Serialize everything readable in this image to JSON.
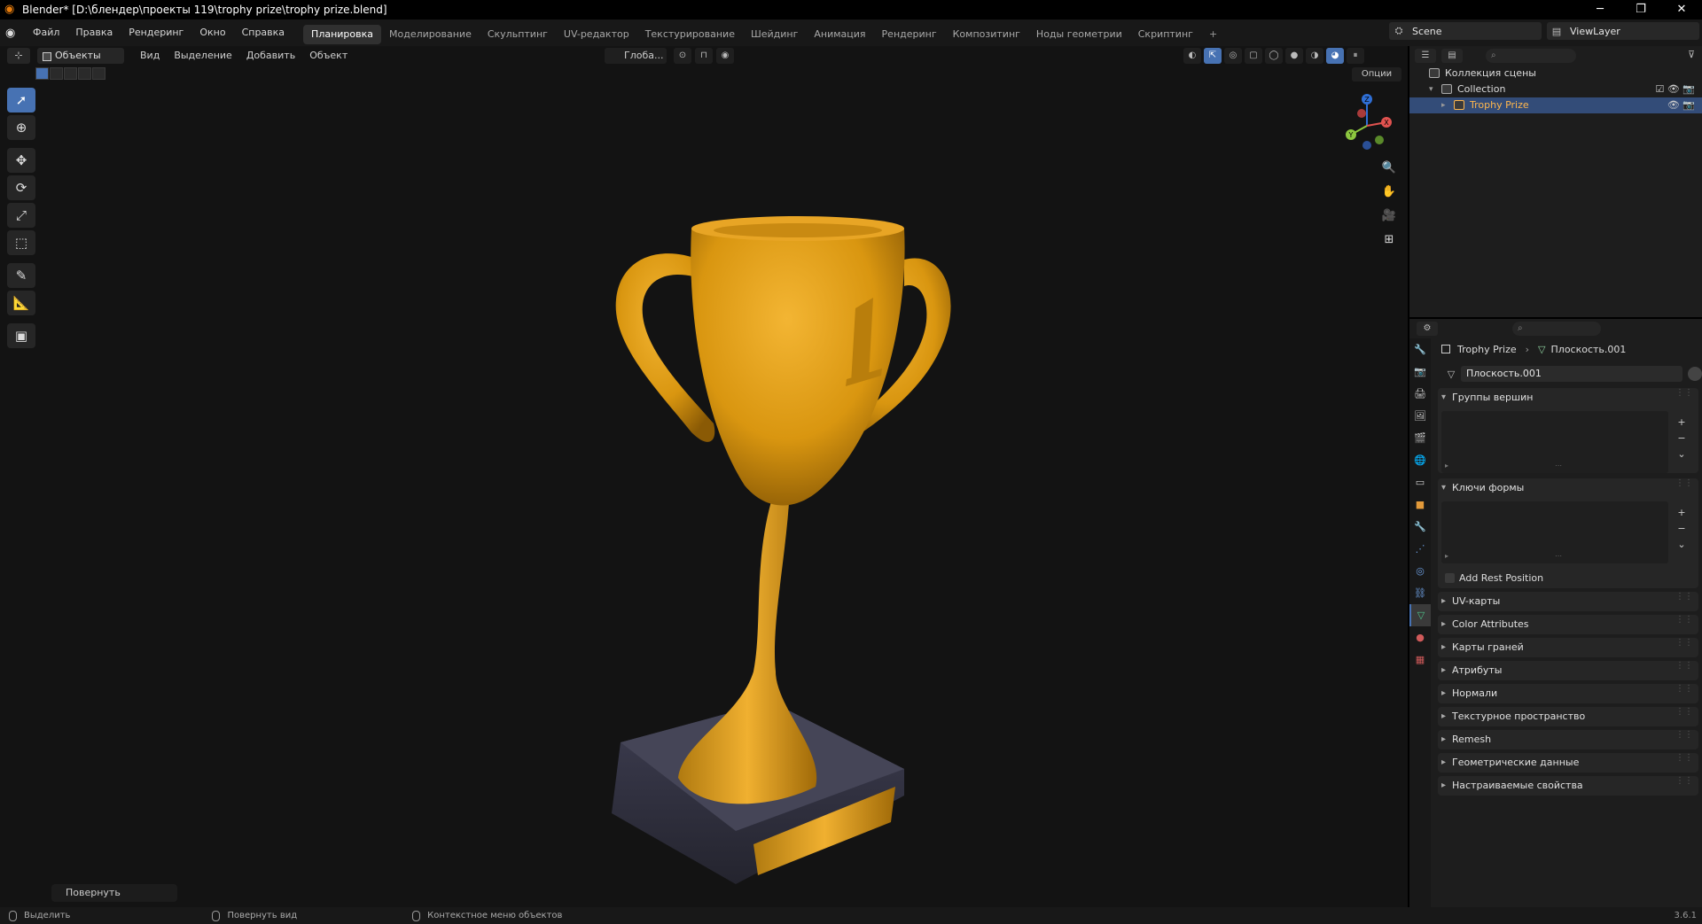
{
  "title": "Blender* [D:\\блендер\\проекты 119\\trophy prize\\trophy prize.blend]",
  "window_controls": {
    "minimize": "─",
    "maximize": "❐",
    "close": "✕"
  },
  "menu": [
    "Файл",
    "Правка",
    "Рендеринг",
    "Окно",
    "Справка"
  ],
  "workspaces": [
    "Планировка",
    "Моделирование",
    "Скульптинг",
    "UV-редактор",
    "Текстурирование",
    "Шейдинг",
    "Анимация",
    "Рендеринг",
    "Композитинг",
    "Ноды геометрии",
    "Скриптинг"
  ],
  "workspace_add": "+",
  "scene": {
    "label": "Scene"
  },
  "view_layer": {
    "label": "ViewLayer"
  },
  "viewport": {
    "mode": "Объекты",
    "menu": [
      "Вид",
      "Выделение",
      "Добавить",
      "Объект"
    ],
    "transform_orientation": "Глоба...",
    "options": "Опции",
    "last_operator": "Повернуть",
    "gizmo_axes": {
      "x": "X",
      "y": "Y",
      "z": "Z"
    },
    "accent": "#4772b3"
  },
  "outliner": {
    "rows": [
      {
        "label": "Коллекция сцены"
      },
      {
        "label": "Collection"
      },
      {
        "label": "Trophy Prize"
      }
    ]
  },
  "properties": {
    "breadcrumb_object": "Trophy Prize",
    "breadcrumb_data": "Плоскость.001",
    "datablock": "Плоскость.001",
    "panels": {
      "vertex_groups": "Группы вершин",
      "shape_keys": "Ключи формы",
      "add_rest_position": "Add Rest Position",
      "uv_maps": "UV-карты",
      "color_attributes": "Color Attributes",
      "face_maps": "Карты граней",
      "attributes": "Атрибуты",
      "normals": "Нормали",
      "texture_space": "Текстурное пространство",
      "remesh": "Remesh",
      "geometry_data": "Геометрические данные",
      "custom_props": "Настраиваемые свойства"
    }
  },
  "statusbar": {
    "select": "Выделить",
    "rotate_view": "Повернуть вид",
    "context_menu": "Контекстное меню объектов",
    "version": "3.6.1"
  }
}
